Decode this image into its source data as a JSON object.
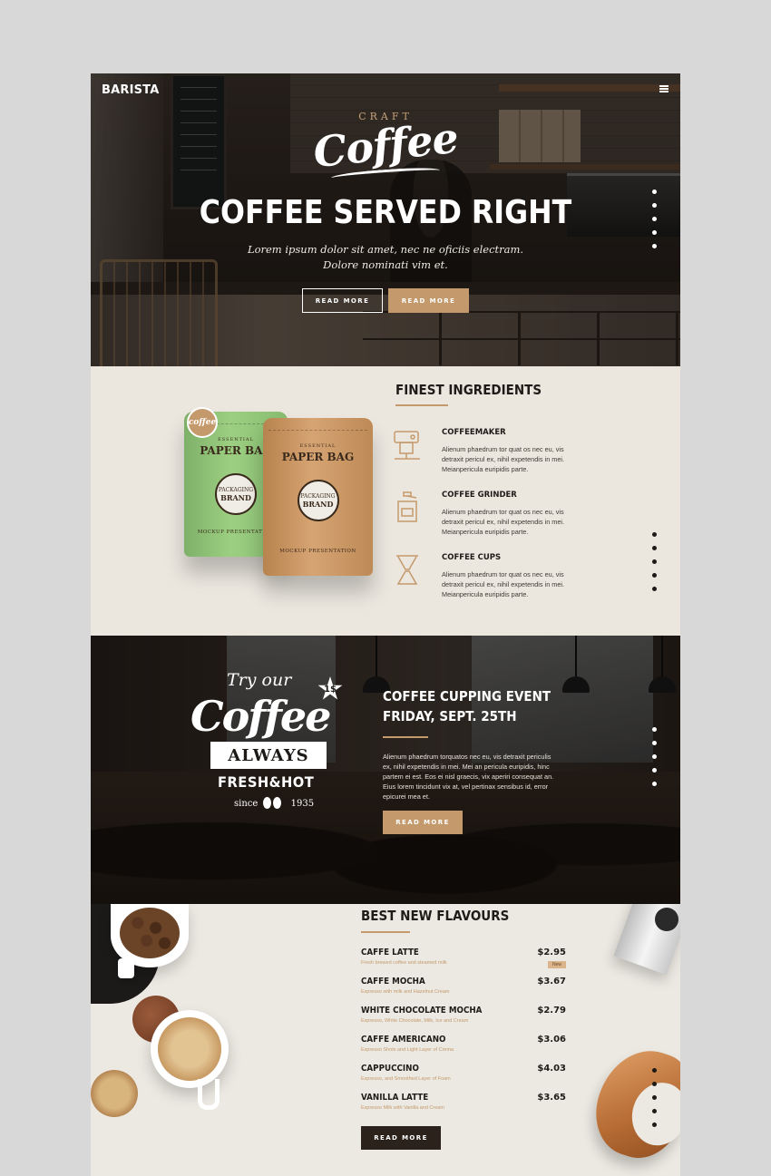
{
  "header": {
    "brand": "BARISTA"
  },
  "hero": {
    "craft_word": "CRAFT",
    "logo_word": "Coffee",
    "title": "COFFEE SERVED RIGHT",
    "subtitle_line1": "Lorem ipsum dolor sit amet, nec ne oficiis electram.",
    "subtitle_line2": "Dolore nominati vim et.",
    "button_primary": "READ MORE",
    "button_secondary": "READ MORE"
  },
  "ingredients": {
    "title": "FINEST INGREDIENTS",
    "product": {
      "badge": "coffee",
      "line1": "ESSENTIAL",
      "name": "PAPER BAG",
      "seal_top": "PACKAGING",
      "seal_main": "BRAND",
      "foot": "MOCKUP PRESENTATION"
    },
    "features": [
      {
        "title": "COFFEEMAKER",
        "text": "Alienum phaedrum tor quat os nec eu, vis detraxit pericul ex, nihil expetendis in mei. Meianpericula euripidis parte."
      },
      {
        "title": "COFFEE GRINDER",
        "text": "Alienum phaedrum tor quat os nec eu, vis detraxit pericul ex, nihil expetendis in mei. Meianpericula euripidis parte."
      },
      {
        "title": "COFFEE CUPS",
        "text": "Alienum phaedrum tor quat os nec eu, vis detraxit pericul ex, nihil expetendis in mei. Meianpericula euripidis parte."
      }
    ]
  },
  "event": {
    "promo": {
      "try": "Try our",
      "price": "1$",
      "script": "Coffee",
      "always": "ALWAYS",
      "fresh": "FRESH&HOT",
      "since": "since",
      "year": "1935"
    },
    "title_line1": "COFFEE CUPPING EVENT",
    "title_line2": "FRIDAY, SEPT. 25TH",
    "text": "Alienum phaedrum torquatos nec eu, vis detraxit periculis ex, nihil expetendis in mei. Mei an pericula euripidis, hinc partem ei est. Eos ei nisl graecis, vix aperiri consequat an. Eius lorem tincidunt vix at, vel pertinax sensibus id, error epicurei mea et.",
    "button": "READ MORE"
  },
  "menu": {
    "title": "BEST NEW FLAVOURS",
    "items": [
      {
        "name": "CAFFE LATTE",
        "price": "$2.95",
        "desc": "Fresh brewed coffee and steamed milk",
        "tag": "New"
      },
      {
        "name": "CAFFE MOCHA",
        "price": "$3.67",
        "desc": "Espresso with milk and Hazelnut Cream"
      },
      {
        "name": "WHITE CHOCOLATE MOCHA",
        "price": "$2.79",
        "desc": "Espresso, White Chocolate, Milk, Ice and Cream"
      },
      {
        "name": "CAFFE AMERICANO",
        "price": "$3.06",
        "desc": "Espresso Shots and Light Layer of Crema"
      },
      {
        "name": "CAPPUCCINO",
        "price": "$4.03",
        "desc": "Espresso, and Smoothed Layer of Foam"
      },
      {
        "name": "VANILLA LATTE",
        "price": "$3.65",
        "desc": "Espresso Milk with Vanilla and Cream"
      }
    ],
    "button": "READ MORE"
  },
  "colors": {
    "accent": "#c49a6c",
    "dark": "#1f1b18",
    "cream": "#ebe7df"
  }
}
